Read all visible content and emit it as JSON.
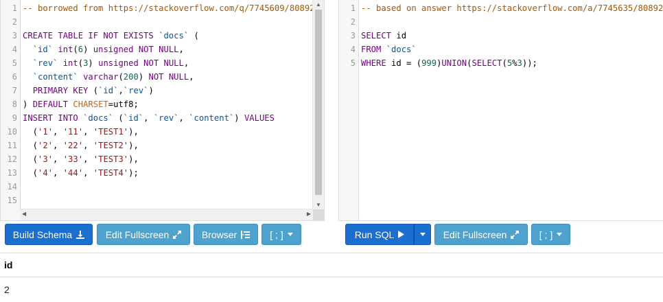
{
  "schema_editor": {
    "line_numbers": [
      "1",
      "2",
      "3",
      "4",
      "5",
      "6",
      "7",
      "8",
      "9",
      "10",
      "11",
      "12",
      "13",
      "14",
      "15"
    ]
  },
  "query_editor": {
    "line_numbers": [
      "1",
      "2",
      "3",
      "4",
      "5"
    ]
  },
  "toolbar_left": {
    "build_schema": "Build Schema",
    "edit_fullscreen": "Edit Fullscreen",
    "browser": "Browser",
    "delimiter": "[ ; ]"
  },
  "toolbar_right": {
    "run_sql": "Run SQL",
    "edit_fullscreen": "Edit Fullscreen",
    "delimiter": "[ ; ]"
  },
  "results": {
    "columns": [
      "id"
    ],
    "rows": [
      [
        "2"
      ]
    ]
  },
  "colors": {
    "primary": "#1a6fd0",
    "info": "#4fa1ce",
    "keyword": "#770088",
    "comment": "#aa5500",
    "string": "#aa1111",
    "number": "#116644"
  }
}
